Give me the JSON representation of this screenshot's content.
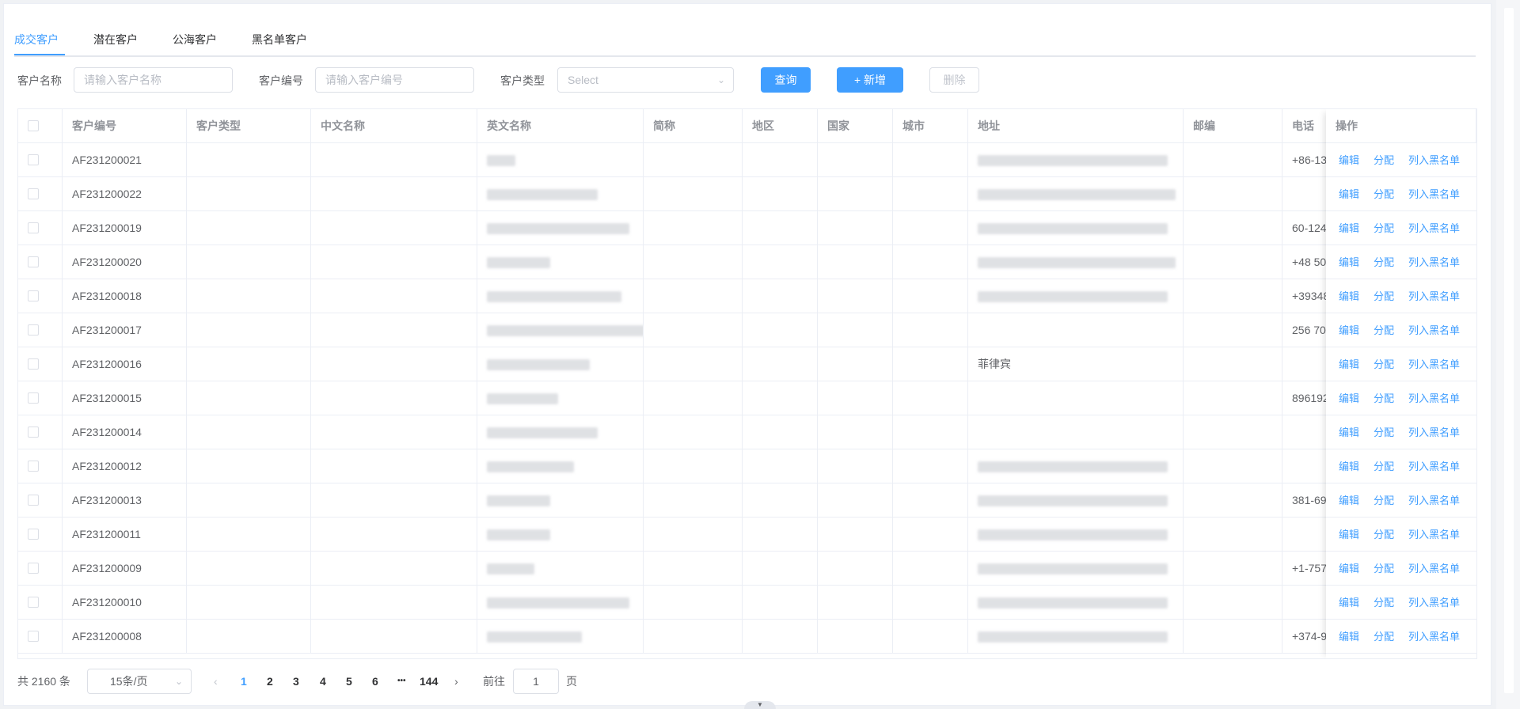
{
  "tabs": [
    {
      "label": "成交客户",
      "active": true
    },
    {
      "label": "潜在客户",
      "active": false
    },
    {
      "label": "公海客户",
      "active": false
    },
    {
      "label": "黑名单客户",
      "active": false
    }
  ],
  "filter": {
    "customer_name_label": "客户名称",
    "customer_name_placeholder": "请输入客户名称",
    "customer_no_label": "客户编号",
    "customer_no_placeholder": "请输入客户编号",
    "customer_type_label": "客户类型",
    "customer_type_placeholder": "Select",
    "query_label": "查询",
    "add_label": "+ 新增",
    "delete_label": "删除"
  },
  "table": {
    "columns": [
      "客户编号",
      "客户类型",
      "中文名称",
      "英文名称",
      "简称",
      "地区",
      "国家",
      "城市",
      "地址",
      "邮编",
      "电话",
      "操作"
    ],
    "ops": {
      "edit": "编辑",
      "assign": "分配",
      "blacklist": "列入黑名单"
    },
    "rows": [
      {
        "id": "AF231200021",
        "address": "",
        "phone": "+86-13"
      },
      {
        "id": "AF231200022",
        "address": "",
        "phone": ""
      },
      {
        "id": "AF231200019",
        "address": "",
        "phone": "60-124"
      },
      {
        "id": "AF231200020",
        "address": "",
        "phone": "+48 50"
      },
      {
        "id": "AF231200018",
        "address": "",
        "phone": "+39348"
      },
      {
        "id": "AF231200017",
        "address": "",
        "phone": "256 70"
      },
      {
        "id": "AF231200016",
        "address": "菲律宾",
        "phone": ""
      },
      {
        "id": "AF231200015",
        "address": "",
        "phone": "896192"
      },
      {
        "id": "AF231200014",
        "address": "",
        "phone": ""
      },
      {
        "id": "AF231200012",
        "address": "",
        "phone": ""
      },
      {
        "id": "AF231200013",
        "address": "",
        "phone": "381-69"
      },
      {
        "id": "AF231200011",
        "address": "",
        "phone": ""
      },
      {
        "id": "AF231200009",
        "address": "",
        "phone": "+1-757"
      },
      {
        "id": "AF231200010",
        "address": "",
        "phone": ""
      },
      {
        "id": "AF231200008",
        "address": "",
        "phone": "+374-9"
      }
    ]
  },
  "pagination": {
    "total_label": "共 2160 条",
    "page_size_label": "15条/页",
    "pages": [
      "1",
      "2",
      "3",
      "4",
      "5",
      "6"
    ],
    "ellipsis": "•••",
    "last_page": "144",
    "current_page": "1",
    "goto_label": "前往",
    "goto_value": "1",
    "page_suffix": "页"
  }
}
